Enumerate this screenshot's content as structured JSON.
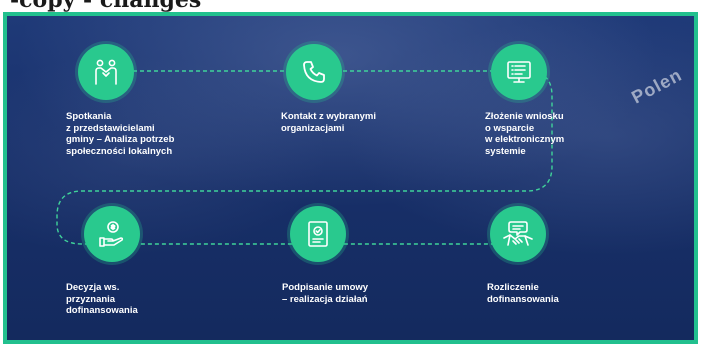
{
  "heading": "-copy - changes",
  "brand": "Polen",
  "steps": [
    {
      "icon": "handshake-people-icon",
      "label": "Spotkania\nz przedstawicielami\ngminy – Analiza potrzeb\nspołeczności lokalnych"
    },
    {
      "icon": "phone-icon",
      "label": "Kontakt z wybranymi\norganizacjami"
    },
    {
      "icon": "application-form-icon",
      "label": "Złożenie wniosku\no wsparcie\nw elektronicznym\nsystemie"
    },
    {
      "icon": "money-hand-icon",
      "label": "Decyzja ws.\nprzyznania\ndofinansowania"
    },
    {
      "icon": "signed-document-icon",
      "label": "Podpisanie umowy\n– realizacja działań"
    },
    {
      "icon": "handshake-chat-icon",
      "label": "Rozliczenie\ndofinansowania"
    }
  ],
  "colors": {
    "accent": "#29c98e",
    "frame": "#22c08e",
    "background": "#18306a"
  }
}
